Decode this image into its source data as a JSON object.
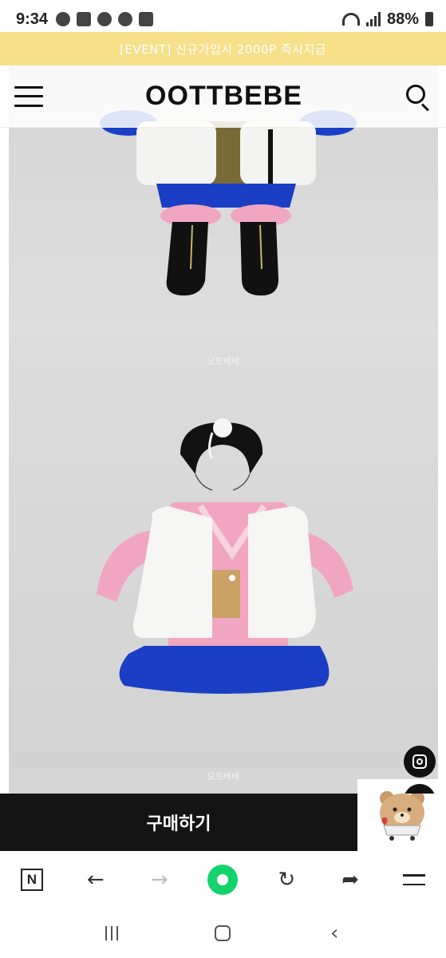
{
  "status_bar": {
    "time": "9:34",
    "battery": "88%",
    "notification_icons": [
      "kakaotalk-icon",
      "gallery-icon",
      "feather-icon",
      "cloud-icon",
      "pencil-icon"
    ]
  },
  "event_banner": {
    "text": "[EVENT] 신규가입시 2000P 즉시지급"
  },
  "header": {
    "logo": "OOTTBEBE"
  },
  "content": {
    "watermark_1": "오뜨베베",
    "watermark_2": "오뜨베베"
  },
  "buy_bar": {
    "label": "구매하기"
  },
  "browser_toolbar": {
    "home_label": "N"
  },
  "colors": {
    "banner_bg": "#f7e08a",
    "buy_bar_bg": "#141414",
    "browser_green": "#13d36b",
    "hanbok_blue": "#1a3fc4",
    "hanbok_pink": "#f0a6c0"
  }
}
